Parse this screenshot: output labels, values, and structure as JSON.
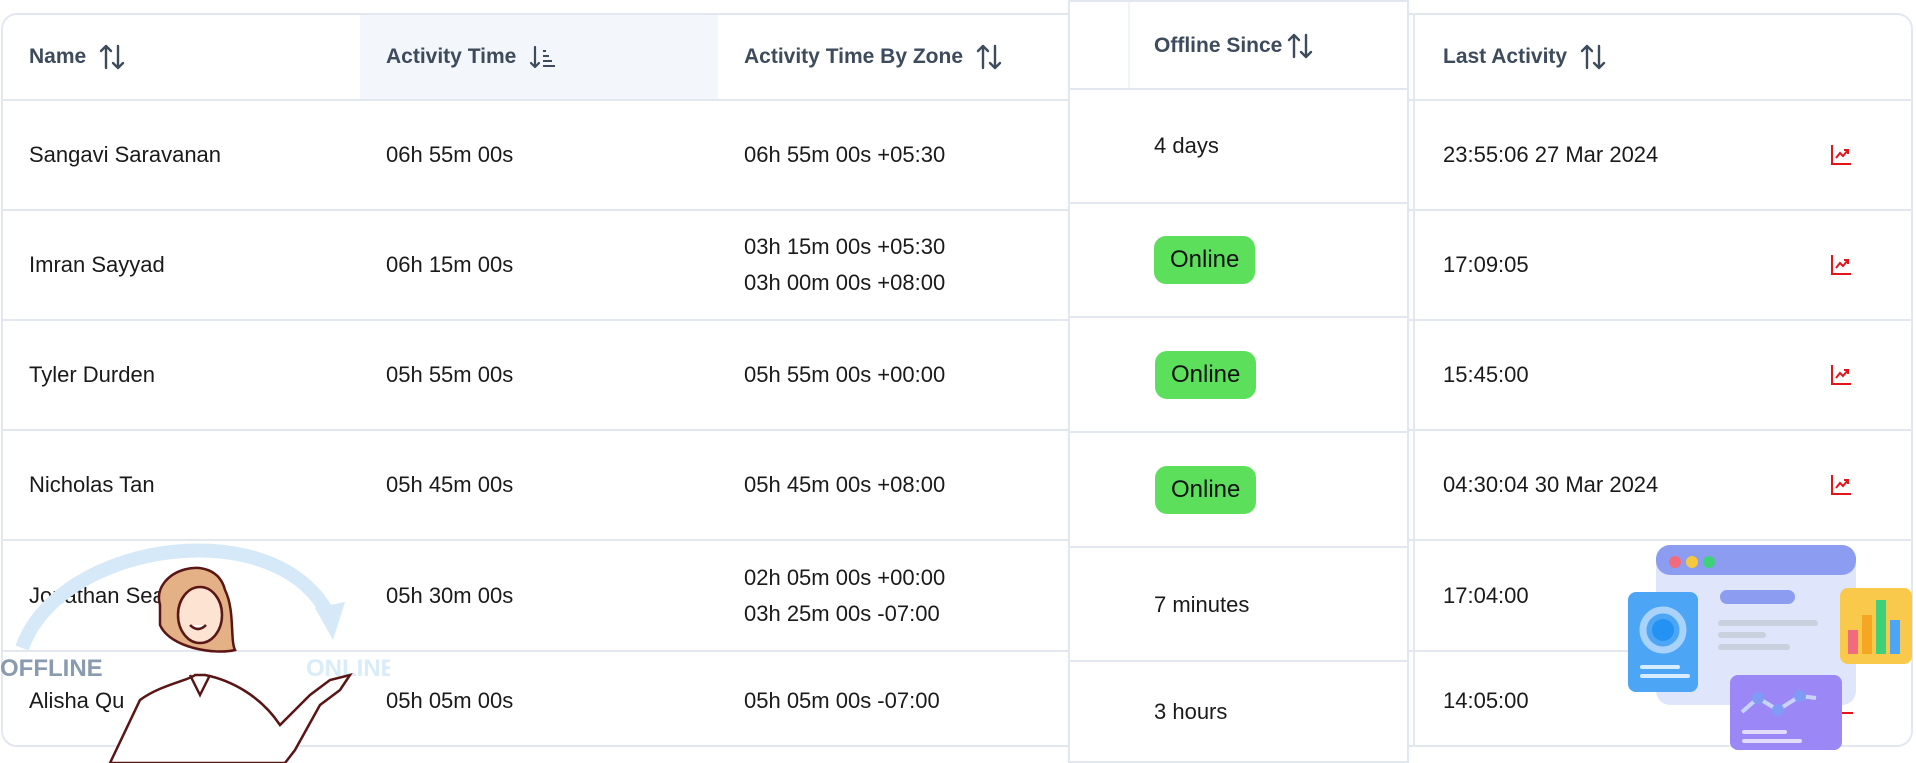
{
  "table": {
    "headers": {
      "name": "Name",
      "activity_time": "Activity Time",
      "activity_by_zone": "Activity Time By Zone",
      "offline_since": "Offline Since",
      "last_activity": "Last Activity"
    },
    "sorted_column": "activity_time",
    "sort_direction": "descending",
    "rows": [
      {
        "name": "Sangavi Saravanan",
        "activity_time": "06h 55m 00s",
        "zones": [
          "06h 55m 00s +05:30"
        ],
        "offline_since": "4 days",
        "online": false,
        "last_activity": "23:55:06 27 Mar 2024"
      },
      {
        "name": "Imran Sayyad",
        "activity_time": "06h 15m 00s",
        "zones": [
          "03h 15m 00s +05:30",
          "03h 00m 00s +08:00"
        ],
        "offline_since": "Online",
        "online": true,
        "last_activity": "17:09:05"
      },
      {
        "name": "Tyler Durden",
        "activity_time": "05h 55m 00s",
        "zones": [
          "05h 55m 00s +00:00"
        ],
        "offline_since": "Online",
        "online": true,
        "last_activity": "15:45:00"
      },
      {
        "name": "Nicholas Tan",
        "activity_time": "05h 45m 00s",
        "zones": [
          "05h 45m 00s +08:00"
        ],
        "offline_since": "Online",
        "online": true,
        "last_activity": "04:30:04 30 Mar 2024"
      },
      {
        "name": "Jonathan Seagull",
        "activity_time": "05h 30m 00s",
        "zones": [
          "02h 05m 00s +00:00",
          "03h 25m 00s -07:00"
        ],
        "offline_since": "7 minutes",
        "online": false,
        "last_activity": "17:04:00"
      },
      {
        "name": "Alisha Qu",
        "activity_time": "05h 05m 00s",
        "zones": [
          "05h 05m 00s -07:00"
        ],
        "offline_since": "3 hours",
        "online": false,
        "last_activity": "14:05:00"
      }
    ]
  },
  "icons": {
    "sort": "sort-up-down-icon",
    "sort_active": "sort-descending-icon",
    "row_action": "trending-chart-icon"
  },
  "illustration": {
    "left_label_from": "OFFLINE",
    "left_label_to": "ONLINE"
  },
  "colors": {
    "header_text": "#3d4b5c",
    "online_badge": "#5ce05c",
    "trend_icon": "#e5141b",
    "border": "#e3e8f0",
    "active_header_bg": "#f3f6fa"
  }
}
